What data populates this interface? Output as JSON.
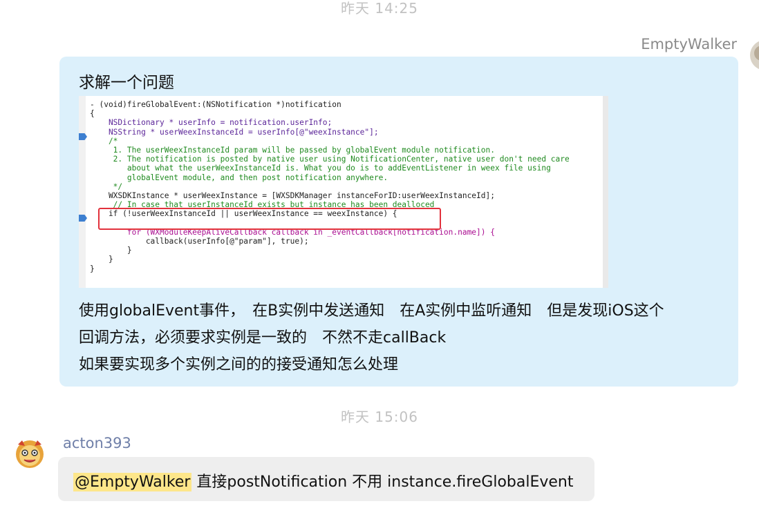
{
  "timestamps": [
    "昨天 14:25",
    "昨天 15:06"
  ],
  "message_right": {
    "sender": "EmptyWalker",
    "title": "求解一个问题",
    "lines": [
      "使用globalEvent事件，　在B实例中发送通知　在A实例中监听通知　但是发现iOS这个",
      "回调方法，必须要求实例是一致的　不然不走callBack",
      "如果要实现多个实例之间的的接受通知怎么处理"
    ],
    "code_screenshot": {
      "lines": [
        "- (void)fireGlobalEvent:(NSNotification *)notification",
        "{",
        "    NSDictionary * userInfo = notification.userInfo;",
        "    NSString * userWeexInstanceId = userInfo[@\"weexInstance\"];",
        "    /*",
        "     1. The userWeexInstanceId param will be passed by globalEvent module notification.",
        "     2. The notification is posted by native user using NotificationCenter, native user don't need care",
        "        about what the userWeexInstanceId is. What you do is to addEventListener in weex file using",
        "        globalEvent module, and then post notification anywhere.",
        "     */",
        "    WXSDKInstance * userWeexInstance = [WXSDKManager instanceForID:userWeexInstanceId];",
        "     // In case that userInstanceId exists but instance has been dealloced",
        "    if (!userWeexInstanceId || userWeexInstance == weexInstance) {",
        "",
        "        for (WXModuleKeepAliveCallback callback in _eventCallback[notification.name]) {",
        "            callback(userInfo[@\"param\"], true);",
        "        }",
        "    }",
        "}"
      ]
    }
  },
  "message_left": {
    "sender": "acton393",
    "mention": "@EmptyWalker",
    "text": " 直接postNotification 不用 instance.fireGlobalEvent"
  },
  "colors": {
    "bubble_right": "#dcf0fb",
    "bubble_left": "#eeeeee",
    "mention_highlight": "#fde68a",
    "highlight_box": "#e2313c"
  }
}
